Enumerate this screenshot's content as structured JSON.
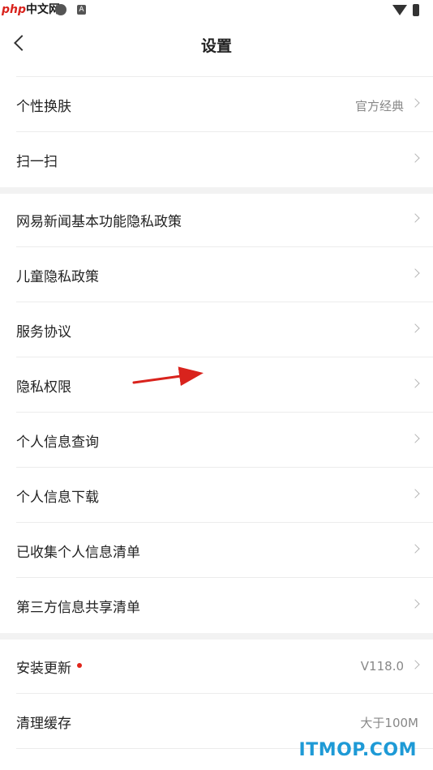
{
  "status_bar": {
    "watermark_left": "中文网",
    "watermark_prefix": "php",
    "a_icon": "A"
  },
  "header": {
    "title": "设置"
  },
  "section1": [
    {
      "label": "个性换肤",
      "value": "官方经典"
    },
    {
      "label": "扫一扫",
      "value": ""
    }
  ],
  "section2": [
    {
      "label": "网易新闻基本功能隐私政策"
    },
    {
      "label": "儿童隐私政策"
    },
    {
      "label": "服务协议"
    },
    {
      "label": "隐私权限"
    },
    {
      "label": "个人信息查询"
    },
    {
      "label": "个人信息下载"
    },
    {
      "label": "已收集个人信息清单"
    },
    {
      "label": "第三方信息共享清单"
    }
  ],
  "section3": [
    {
      "label": "安装更新",
      "value": "V118.0"
    },
    {
      "label": "清理缓存",
      "value": "大于100M"
    }
  ],
  "watermark": "ITMOP.COM",
  "colors": {
    "arrow": "#d9231d",
    "update_dot": "#e0251b",
    "watermark": "#1e9ad6"
  },
  "icons": [
    "back-chevron-icon",
    "chevron-right-icon",
    "wifi-icon",
    "battery-icon"
  ]
}
